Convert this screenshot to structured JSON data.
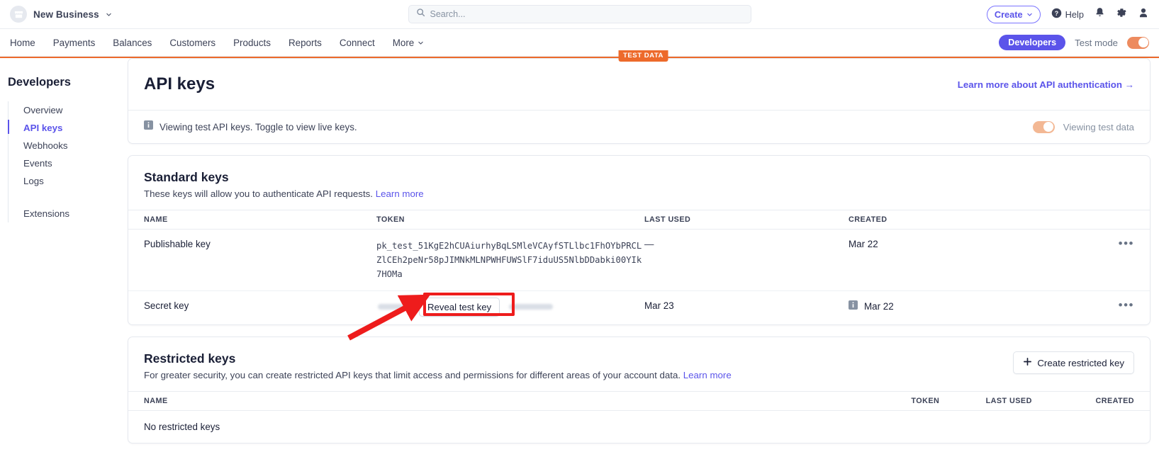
{
  "topbar": {
    "brand_name": "New Business",
    "brand_icon": "store-icon",
    "chevron_icon": "chevron-down-icon",
    "search_placeholder": "Search...",
    "search_value": "",
    "search_icon": "search-icon",
    "create_label": "Create",
    "help_label": "Help",
    "help_icon": "question-circle-icon",
    "notifications_icon": "bell-icon",
    "settings_icon": "gear-icon",
    "account_icon": "user-avatar-icon"
  },
  "nav": {
    "items": [
      {
        "label": "Home",
        "has_caret": false
      },
      {
        "label": "Payments",
        "has_caret": false
      },
      {
        "label": "Balances",
        "has_caret": false
      },
      {
        "label": "Customers",
        "has_caret": false
      },
      {
        "label": "Products",
        "has_caret": false
      },
      {
        "label": "Reports",
        "has_caret": false
      },
      {
        "label": "Connect",
        "has_caret": false
      },
      {
        "label": "More",
        "has_caret": true
      }
    ],
    "developers_label": "Developers",
    "test_mode_label": "Test mode",
    "test_mode_on": true
  },
  "sidebar": {
    "title": "Developers",
    "items": [
      {
        "label": "Overview",
        "active": false
      },
      {
        "label": "API keys",
        "active": true
      },
      {
        "label": "Webhooks",
        "active": false
      },
      {
        "label": "Events",
        "active": false
      },
      {
        "label": "Logs",
        "active": false
      }
    ],
    "extra_items": [
      {
        "label": "Extensions",
        "active": false
      }
    ]
  },
  "test_data_badge": "TEST DATA",
  "header": {
    "title": "API keys",
    "learn_more_link": "Learn more about API authentication →"
  },
  "banner": {
    "info_icon": "info-icon",
    "text": "Viewing test API keys. Toggle to view live keys.",
    "toggle_label": "Viewing test data",
    "toggle_on": true
  },
  "standard_keys": {
    "title": "Standard keys",
    "description": "These keys will allow you to authenticate API requests.",
    "description_link": "Learn more",
    "columns": [
      "NAME",
      "TOKEN",
      "LAST USED",
      "CREATED"
    ],
    "rows": [
      {
        "name": "Publishable key",
        "token": "pk_test_51KgE2hCUAiurhyBqLSMleVCAyfSTLlbc1FhOYbPRCLZlCEh2peNr58pJIMNkMLNPWHFUWSlF7iduUS5NlbDDabki00YIk7HOMa",
        "token_masked": false,
        "last_used": "—",
        "created": "Mar 22",
        "created_has_info_icon": false,
        "overflow_icon": "ellipsis-icon"
      },
      {
        "name": "Secret key",
        "token": "",
        "token_masked": true,
        "reveal_button_label": "Reveal test key",
        "last_used": "Mar 23",
        "created": "Mar 22",
        "created_has_info_icon": true,
        "overflow_icon": "ellipsis-icon"
      }
    ]
  },
  "restricted_keys": {
    "title": "Restricted keys",
    "description": "For greater security, you can create restricted API keys that limit access and permissions for different areas of your account data.",
    "description_link": "Learn more",
    "create_button_label": "Create restricted key",
    "create_button_icon": "plus-icon",
    "columns": [
      "NAME",
      "TOKEN",
      "LAST USED",
      "CREATED"
    ],
    "empty_message": "No restricted keys"
  },
  "annotation": {
    "highlight_target": "Reveal test key",
    "color": "#ee1c1c",
    "shape": "box-with-arrow"
  }
}
